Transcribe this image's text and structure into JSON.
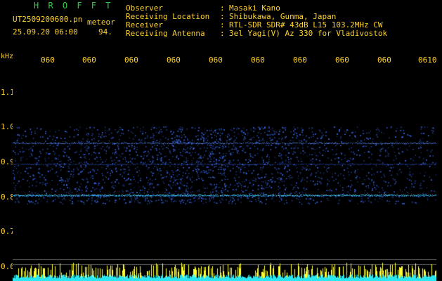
{
  "header": {
    "brand": "H R O F F T",
    "filename": "UT2509200600.pn",
    "tag": "meteor",
    "datetime": "25.09.20 06:00",
    "count": "94."
  },
  "meta": {
    "observer_label": "Observer",
    "observer": "Masaki Kano",
    "location_label": "Receiving Location",
    "location": "Shibukawa, Gunma, Japan",
    "receiver_label": "Receiver",
    "receiver": "RTL-SDR SDR# 43dB L15 103.2MHz CW",
    "antenna_label": "Receiving Antenna",
    "antenna": "3el Yagi(V) Az 330 for Vladivostok",
    "separator": ":"
  },
  "axes": {
    "y_unit": "kHz",
    "x_ticks": [
      "060",
      "060",
      "060",
      "060",
      "060",
      "060",
      "060",
      "060",
      "060",
      "0610"
    ],
    "y_ticks": [
      "1.1",
      "1.0",
      "0.9",
      "0.8",
      "0.7",
      "0.6"
    ]
  },
  "colors": {
    "text": "#ffd22e",
    "brand": "#2ecc40",
    "signal": "#2a5cff",
    "baseline": "#29e6f0",
    "spike": "#ffff33"
  }
}
